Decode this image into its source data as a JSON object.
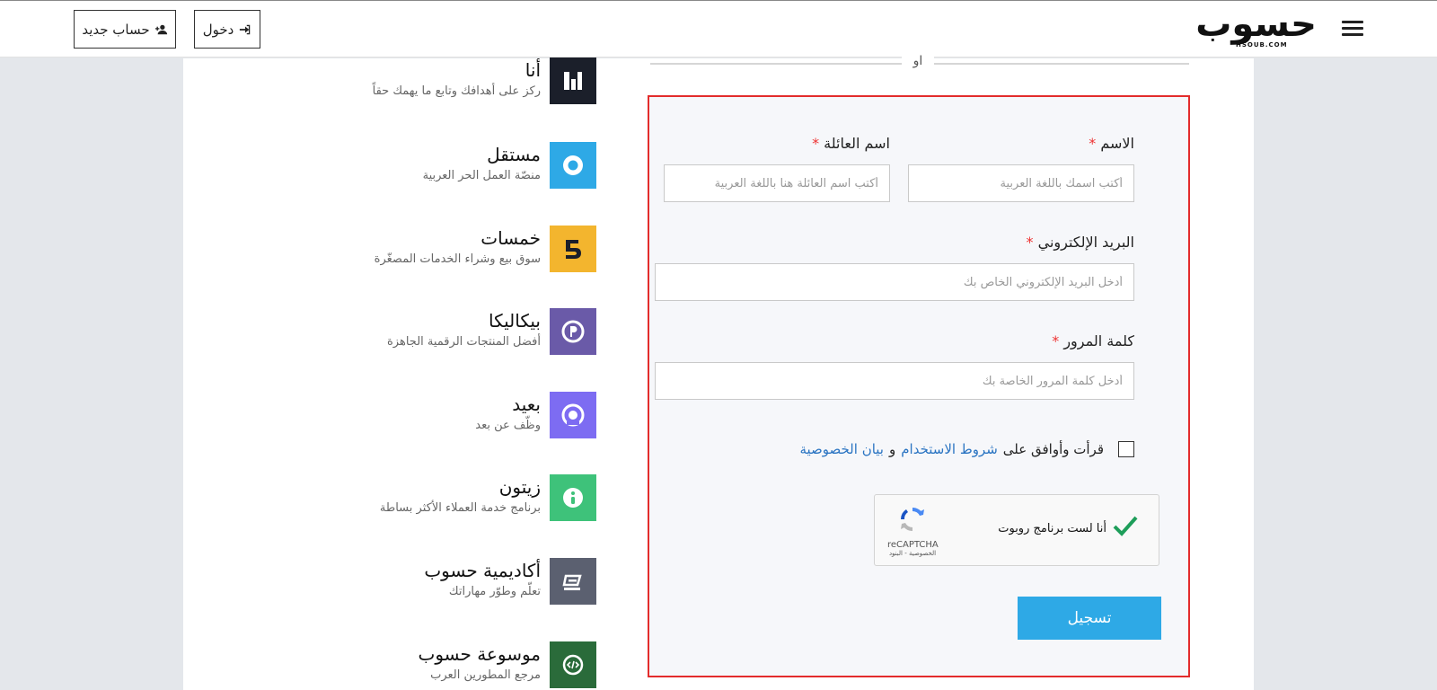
{
  "header": {
    "register_label": "حساب جديد",
    "login_label": "دخول",
    "logo_text": "حسوب",
    "logo_sub": "HSOUB.COM"
  },
  "products": [
    {
      "name": "أنا",
      "desc": "ركز على أهدافك وتابع ما يهمك حقاً",
      "icon": "ana-icon",
      "color": "#1b1f2a"
    },
    {
      "name": "مستقل",
      "desc": "منصّة العمل الحر العربية",
      "icon": "mostaql-icon",
      "color": "#2ea9e6"
    },
    {
      "name": "خمسات",
      "desc": "سوق بيع وشراء الخدمات المصغّرة",
      "icon": "khamsat-icon",
      "color": "#f3b52e"
    },
    {
      "name": "بيكاليكا",
      "desc": "أفضل المنتجات الرقمية الجاهزة",
      "icon": "baaeed-p-icon",
      "color": "#6a5aa8"
    },
    {
      "name": "بعيد",
      "desc": "وظّف عن بعد",
      "icon": "baaeed-icon",
      "color": "#7d6cf2"
    },
    {
      "name": "زيتون",
      "desc": "برنامج خدمة العملاء الأكثر بساطة",
      "icon": "zaytoon-icon",
      "color": "#3ec27a"
    },
    {
      "name": "أكاديمية حسوب",
      "desc": "تعلّم وطوّر مهاراتك",
      "icon": "academy-icon",
      "color": "#5b6070"
    },
    {
      "name": "موسوعة حسوب",
      "desc": "مرجع المطورين العرب",
      "icon": "wiki-icon",
      "color": "#2a6b3a"
    }
  ],
  "divider": {
    "or_text": "او"
  },
  "form": {
    "first_name_label": "الاسم",
    "first_name_placeholder": "أكتب اسمك باللغة العربية",
    "last_name_label": "اسم العائلة",
    "last_name_placeholder": "أكتب اسم العائلة هنا باللغة العربية",
    "email_label": "البريد الإلكتروني",
    "email_placeholder": "أدخل البريد الإلكتروني الخاص بك",
    "password_label": "كلمة المرور",
    "password_placeholder": "أدخل كلمة المرور الخاصة بك",
    "required_mark": "*",
    "terms_prefix": "قرأت وأوافق على",
    "terms_link": "شروط الاستخدام",
    "terms_and": "و",
    "privacy_link": "بيان الخصوصية",
    "submit_label": "تسجيل"
  },
  "captcha": {
    "text": "أنا لست برنامج روبوت",
    "brand": "reCAPTCHA",
    "links": "الخصوصية - البنود",
    "checked": true,
    "check_color": "#1e9e5a"
  },
  "colors": {
    "accent": "#2ea9e6",
    "form_border": "#e32c2c",
    "link": "#2a74c2"
  }
}
